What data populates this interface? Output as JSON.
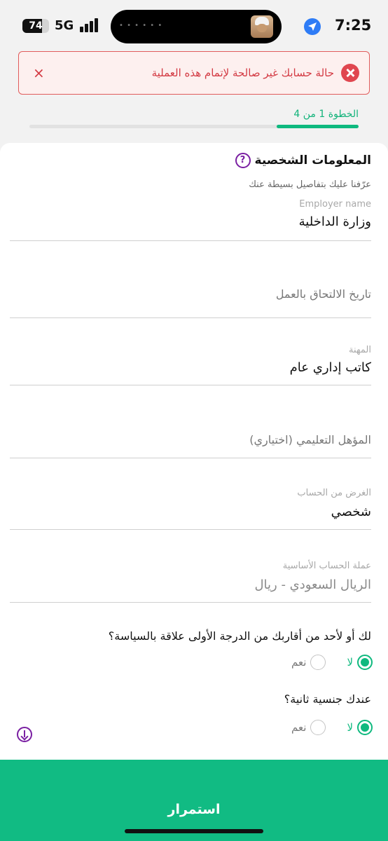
{
  "status_bar": {
    "time": "7:25",
    "network": "5G",
    "battery": "74",
    "battery_level": 0.74
  },
  "error_banner": {
    "message": "حالة حسابك غير صالحة لإتمام هذه العملية",
    "close": "×"
  },
  "step": {
    "label": "الخطوة 1 من 4",
    "current": 1,
    "total": 4
  },
  "section": {
    "title": "المعلومات الشخصية",
    "help": "?",
    "subtitle": "عرّفنا عليك بتفاصيل بسيطة عنك"
  },
  "fields": {
    "employer": {
      "label": "Employer name",
      "value": "وزارة الداخلية"
    },
    "join_date": {
      "placeholder": "تاريخ الالتحاق بالعمل"
    },
    "occupation": {
      "label": "المهنة",
      "value": "كاتب إداري عام"
    },
    "education": {
      "placeholder": "المؤهل التعليمي (اختياري)"
    },
    "purpose": {
      "label": "الغرض من الحساب",
      "value": "شخصي"
    },
    "currency": {
      "label": "عملة الحساب الأساسية",
      "value": "الريال السعودي - ريال"
    }
  },
  "questions": {
    "politics": {
      "text": "لك أو لأحد من أقاربك من الدرجة الأولى علاقة بالسياسة؟",
      "yes": "نعم",
      "no": "لا",
      "selected": "no"
    },
    "nationality": {
      "text": "عندك جنسية ثانية؟",
      "yes": "نعم",
      "no": "لا",
      "selected": "no"
    }
  },
  "footer": {
    "continue_label": "استمرار"
  },
  "colors": {
    "accent": "#11bb83",
    "error": "#d33a43",
    "help": "#7a1fa2"
  }
}
